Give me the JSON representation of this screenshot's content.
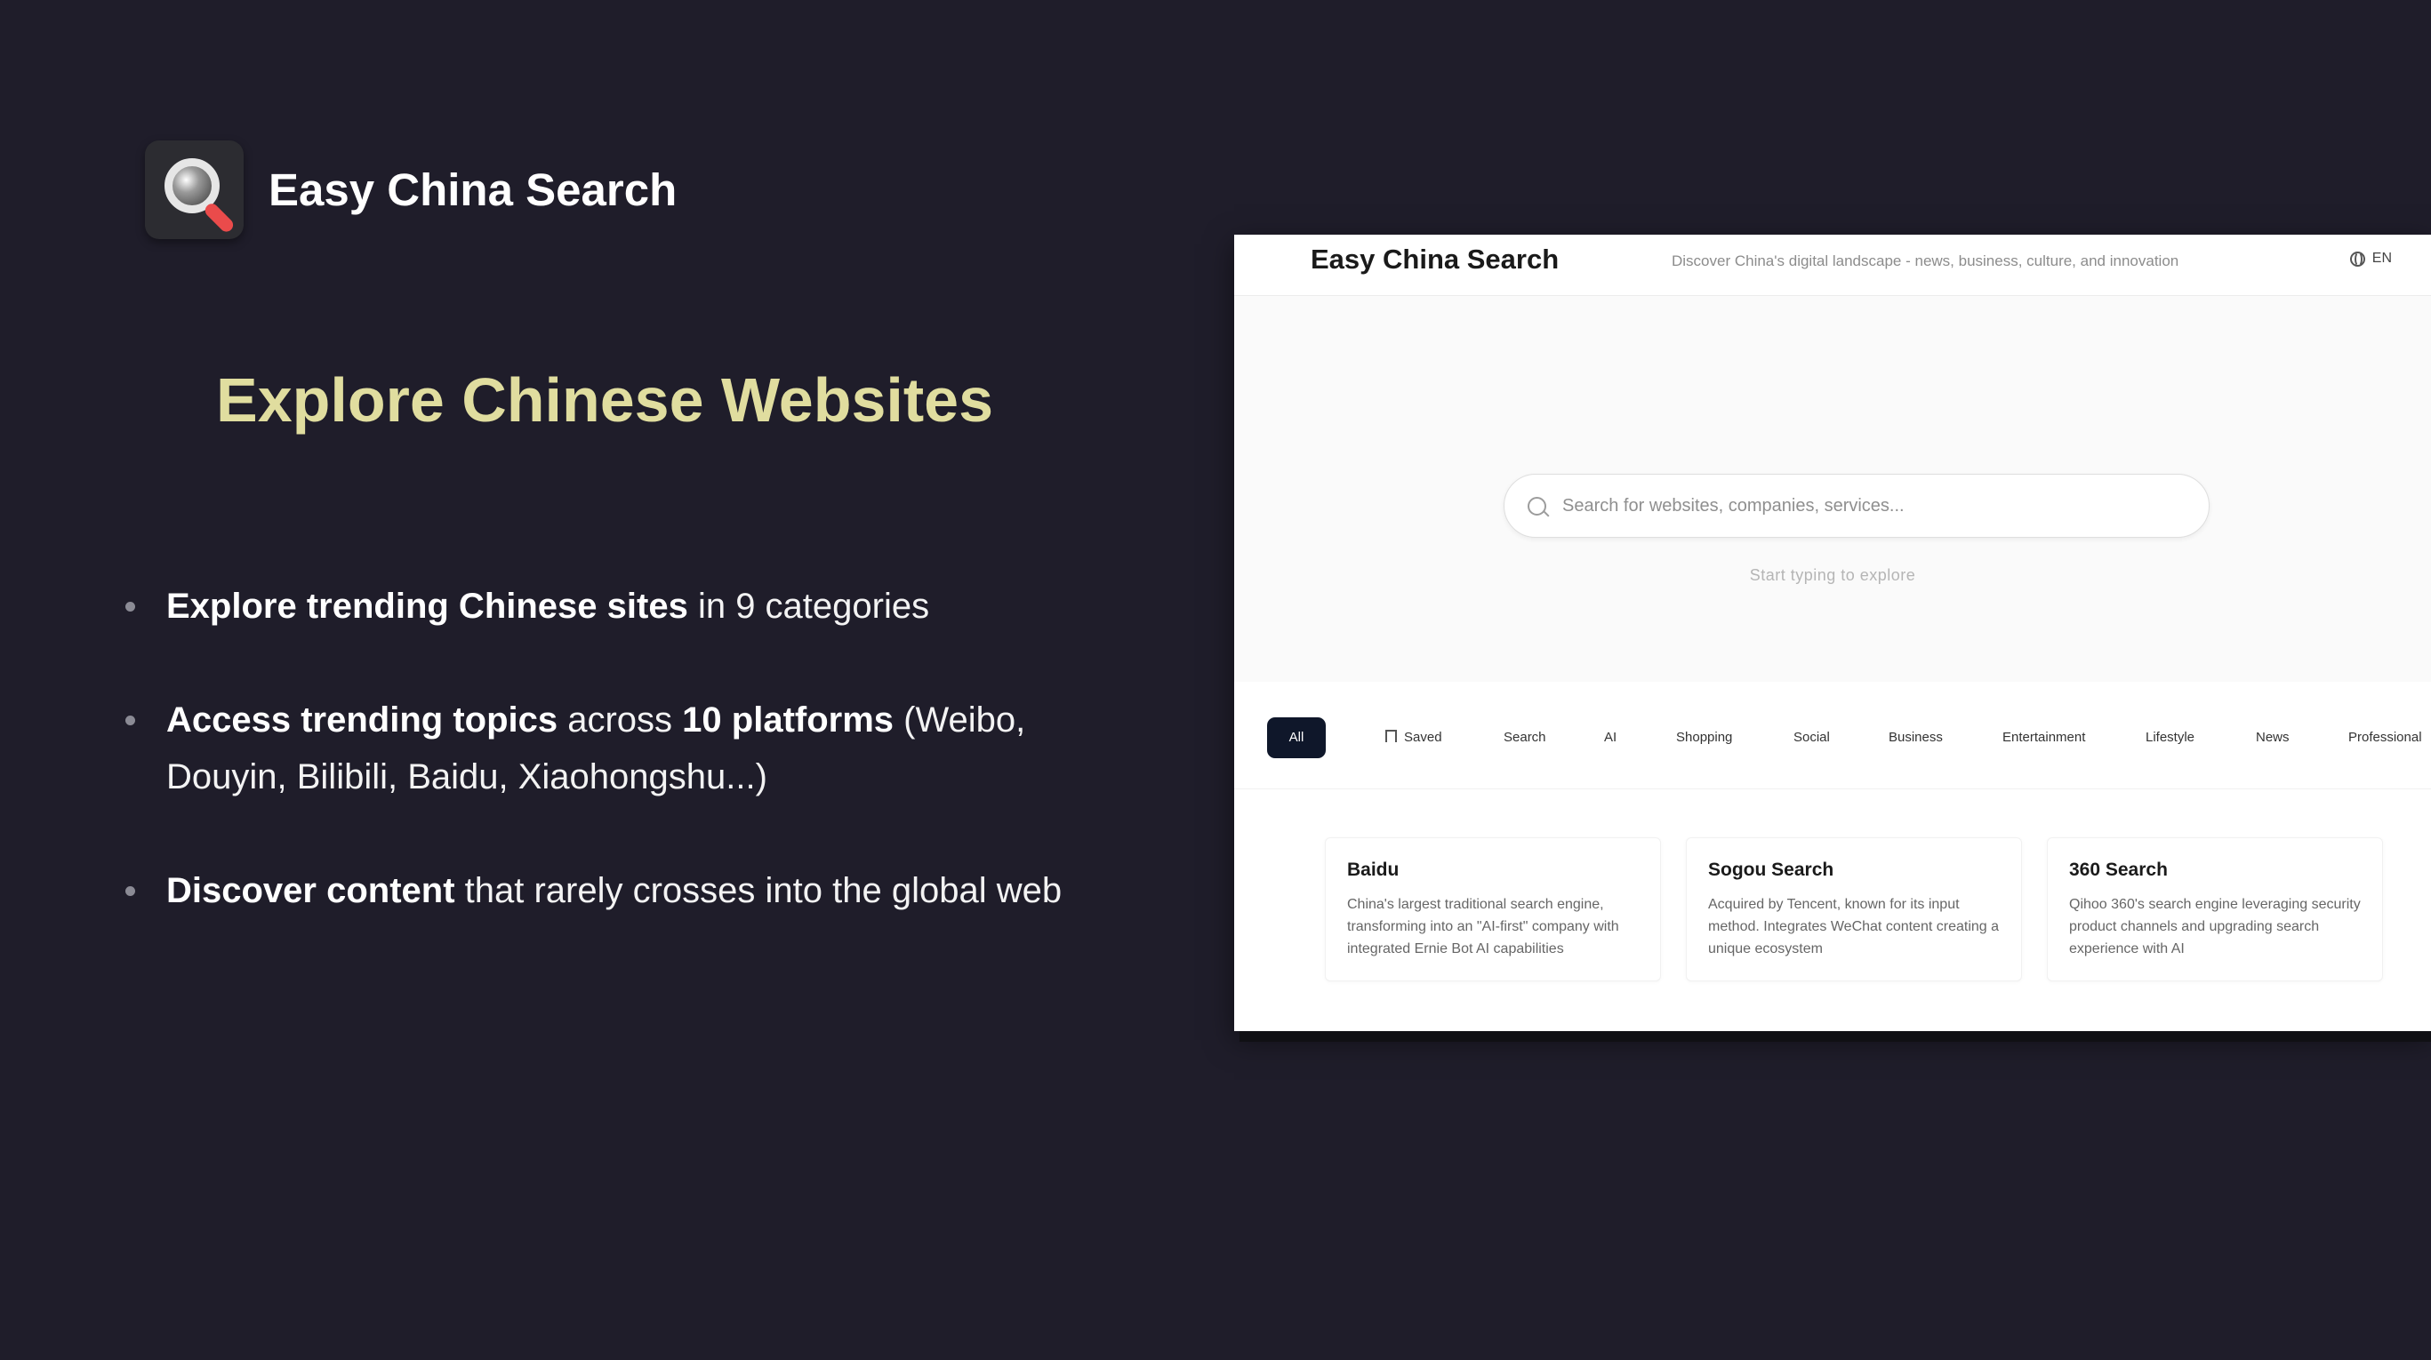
{
  "brand": {
    "name": "Easy China Search"
  },
  "headline": "Explore Chinese Websites",
  "features": [
    {
      "bold": "Explore trending Chinese sites",
      "text": " in 9 categories"
    },
    {
      "bold": "Access trending topics",
      "text": " across ",
      "bold2": "10 platforms",
      "text2": " (Weibo, Douyin, Bilibili, Baidu, Xiaohongshu...)"
    },
    {
      "bold": "Discover content",
      "text": " that rarely crosses into the global web"
    }
  ],
  "app": {
    "title": "Easy China Search",
    "tagline": "Discover China's digital landscape - news, business, culture, and innovation",
    "language": "EN",
    "search": {
      "placeholder": "Search for websites, companies, services...",
      "value": "",
      "hint": "Start typing to explore"
    },
    "tabs": [
      "All",
      "Saved",
      "Search",
      "AI",
      "Shopping",
      "Social",
      "Business",
      "Entertainment",
      "Lifestyle",
      "News",
      "Professional"
    ],
    "active_tab": "All",
    "cards": [
      {
        "title": "Baidu",
        "description": "China's largest traditional search engine, transforming into an \"AI-first\" company with integrated Ernie Bot AI capabilities"
      },
      {
        "title": "Sogou Search",
        "description": "Acquired by Tencent, known for its input method. Integrates WeChat content creating a unique ecosystem"
      },
      {
        "title": "360 Search",
        "description": "Qihoo 360's search engine leveraging security product channels and upgrading search experience with AI"
      }
    ]
  },
  "icons": {
    "app_logo": "magnifier-icon",
    "language": "globe-icon",
    "search": "search-icon",
    "saved": "bookmark-icon"
  },
  "colors": {
    "background": "#1f1d2a",
    "headline": "#e0dd9f",
    "active_tab": "#0f172a",
    "logo_handle": "#ea4b4b"
  }
}
